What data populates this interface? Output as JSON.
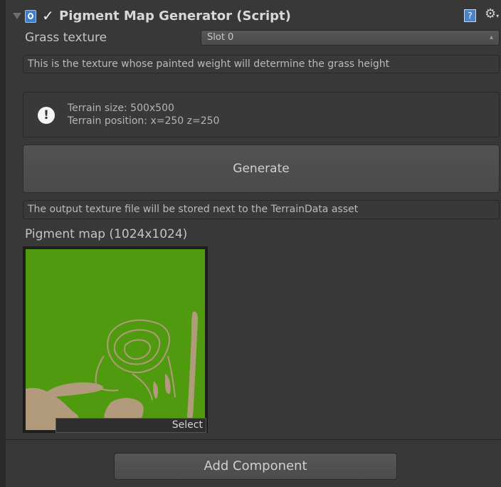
{
  "component": {
    "title": "Pigment Map Generator (Script)",
    "enabled_check": "✓",
    "help_glyph": "?",
    "settings_glyph": "⚙"
  },
  "grass_texture": {
    "label": "Grass texture",
    "value": "Slot 0"
  },
  "help_text": "This is the texture whose painted weight will determine the grass height",
  "terrain_info": {
    "size": "Terrain size: 500x500",
    "position": "Terrain position: x=250 z=250"
  },
  "generate_label": "Generate",
  "output_note": "The output texture file will be stored next to the TerrainData asset",
  "pigment_map": {
    "label": "Pigment map (1024x1024)",
    "select_label": "Select"
  },
  "add_component_label": "Add Component",
  "colors": {
    "panel_bg": "#383838",
    "map_grass": "#4f9a0f",
    "map_dirt": "#b29a7c"
  }
}
